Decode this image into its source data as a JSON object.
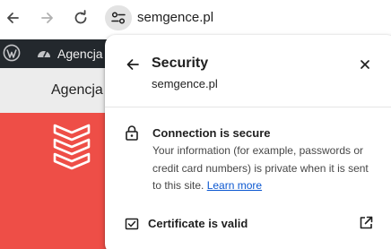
{
  "browser": {
    "url": "semgence.pl",
    "back_icon": "arrow-left-icon",
    "forward_icon": "arrow-right-icon",
    "reload_icon": "reload-icon",
    "site_info_icon": "tune-icon"
  },
  "wp_admin_bar": {
    "site_name": "Agencja S"
  },
  "site": {
    "nav_text": "Agencja",
    "hero_color": "#ee4e47"
  },
  "popup": {
    "title": "Security",
    "subtitle": "semgence.pl",
    "connection_title": "Connection is secure",
    "connection_desc": "Your information (for example, passwords or credit card numbers) is private when it is sent to this site.",
    "learn_more": "Learn more",
    "certificate_label": "Certificate is valid",
    "link_color": "#0b57d0"
  }
}
